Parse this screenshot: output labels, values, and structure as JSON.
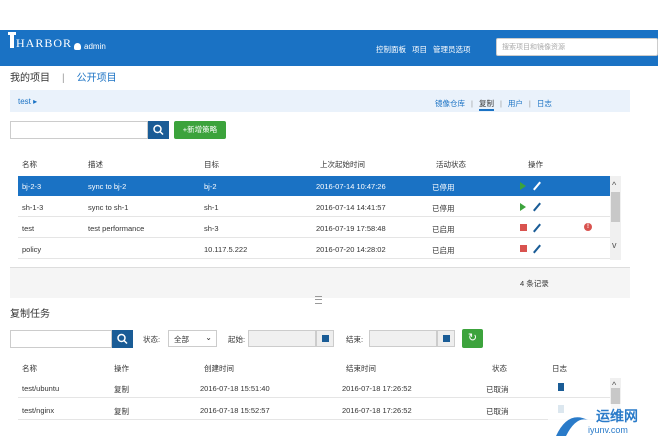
{
  "header": {
    "logo": "HARBOR",
    "user": "admin",
    "nav": [
      "控制面板",
      "项目",
      "管理员选项"
    ],
    "search_placeholder": "搜索项目和镜像资源"
  },
  "tabs": {
    "my_projects": "我的项目",
    "sep": "|",
    "public_projects": "公开项目"
  },
  "breadcrumb": {
    "project": "test ▸"
  },
  "subnav": [
    "镜像仓库",
    "复制",
    "用户",
    "日志"
  ],
  "policy_toolbar": {
    "add_label": "+新增策略"
  },
  "policy_table": {
    "headers": [
      "名称",
      "描述",
      "目标",
      "上次起始时间",
      "活动状态",
      "操作"
    ],
    "rows": [
      {
        "name": "bj-2-3",
        "desc": "sync to bj-2",
        "target": "bj-2",
        "time": "2016-07-14 10:47:26",
        "status": "已停用"
      },
      {
        "name": "sh-1-3",
        "desc": "sync to sh-1",
        "target": "sh-1",
        "time": "2016-07-14 14:41:57",
        "status": "已停用"
      },
      {
        "name": "test",
        "desc": "test performance",
        "target": "sh-3",
        "time": "2016-07-19 17:58:48",
        "status": "已启用"
      },
      {
        "name": "policy",
        "desc": "",
        "target": "10.117.5.222",
        "time": "2016-07-20 14:28:02",
        "status": "已启用"
      }
    ],
    "records": "4 条记录"
  },
  "jobs": {
    "title": "复制任务",
    "status_label": "状态:",
    "status_value": "全部",
    "start_label": "起始:",
    "end_label": "结束:",
    "headers": [
      "名称",
      "操作",
      "创建时间",
      "结束时间",
      "状态",
      "日志"
    ],
    "rows": [
      {
        "name": "test/ubuntu",
        "op": "复制",
        "created": "2016-07-18 15:51:40",
        "ended": "2016-07-18 17:26:52",
        "status": "已取消"
      },
      {
        "name": "test/nginx",
        "op": "复制",
        "created": "2016-07-18 15:52:57",
        "ended": "2016-07-18 17:26:52",
        "status": "已取消"
      }
    ]
  },
  "watermark": {
    "line1": "运维网",
    "line2": "iyunv.com"
  },
  "colors": {
    "header": "#1a72c4",
    "selected_row": "#1a72c4",
    "green": "#3ca33c",
    "red": "#d9534f"
  }
}
